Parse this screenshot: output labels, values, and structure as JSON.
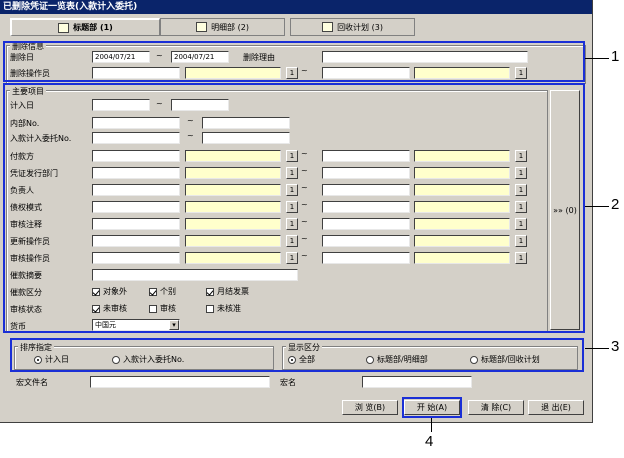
{
  "window": {
    "title": "已删除凭证一览表(入款计入委托)"
  },
  "tabs": [
    {
      "label": "标题部 (1)"
    },
    {
      "label": "明细部 (2)"
    },
    {
      "label": "回收计划 (3)"
    }
  ],
  "delete_info": {
    "group_label": "删除信息",
    "date_label": "删除日",
    "date_from": "2004/07/21",
    "date_to": "2004/07/21",
    "tilde": "~",
    "reason_label": "删除理由",
    "operator_label": "删除操作员"
  },
  "main_items": {
    "group_label": "主要项目",
    "entry_date_label": "计入日",
    "internal_no_label": "内部No.",
    "deposit_no_label": "入款计入委托No.",
    "payer_label": "付款方",
    "issuing_dept_label": "凭证发行部门",
    "person_label": "负责人",
    "claim_style_label": "债权模式",
    "review_note_label": "审核注释",
    "update_operator_label": "更新操作员",
    "review_operator_label": "审核操作员",
    "collection_summary_label": "催款摘要",
    "collection_class_label": "催款区分",
    "class_options": [
      "对象外",
      "个别",
      "月结发票"
    ],
    "review_status_label": "审核状态",
    "status_options": [
      "未审核",
      "审核",
      "未核准"
    ],
    "currency_label": "货币",
    "currency_value": "中国元",
    "expand_button": "»» (0)"
  },
  "sort": {
    "group_label": "排序指定",
    "options": [
      "计入日",
      "入款计入委托No."
    ]
  },
  "display": {
    "group_label": "显示区分",
    "options": [
      "全部",
      "标题部/明细部",
      "标题部/回收计划"
    ]
  },
  "macro": {
    "file_label": "宏文件名",
    "name_label": "宏名"
  },
  "buttons": {
    "browse": "浏 览(B)",
    "start": "开 始(A)",
    "clear": "清 除(C)",
    "exit": "退 出(E)"
  },
  "callouts": [
    "1",
    "2",
    "3",
    "4"
  ],
  "lookup_button": "1"
}
